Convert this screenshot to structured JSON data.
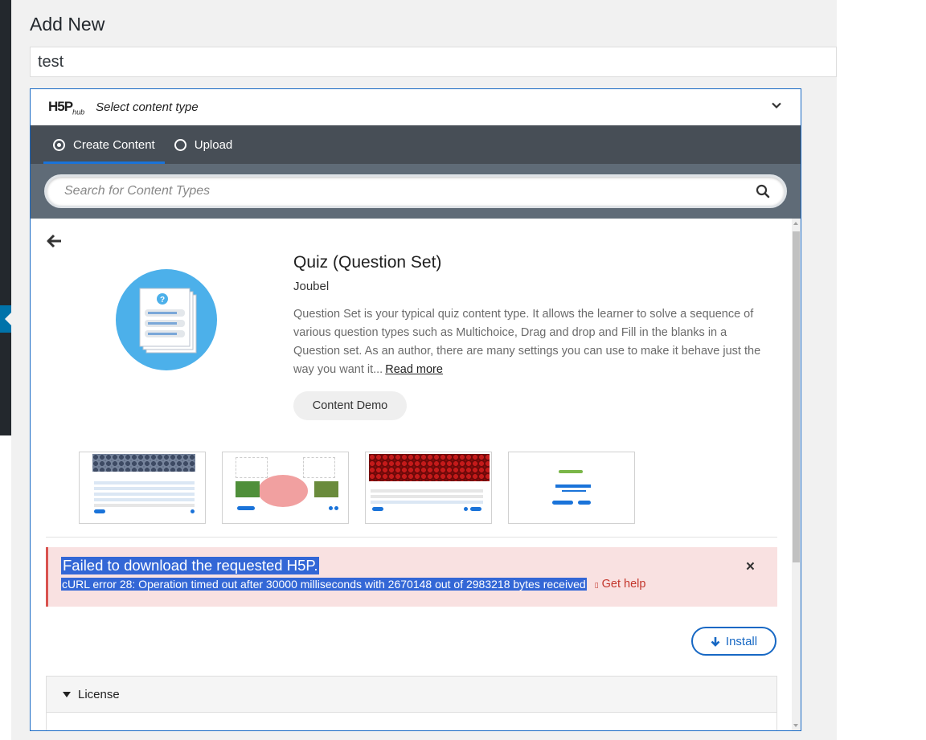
{
  "page": {
    "title": "Add New",
    "title_input_value": "test"
  },
  "hub": {
    "logo_text": "H5P",
    "logo_sub": "hub",
    "select_label": "Select content type",
    "tabs": [
      {
        "label": "Create Content",
        "selected": true
      },
      {
        "label": "Upload",
        "selected": false
      }
    ],
    "search_placeholder": "Search for Content Types"
  },
  "detail": {
    "title": "Quiz (Question Set)",
    "owner": "Joubel",
    "description": "Question Set is your typical quiz content type. It allows the learner to solve a sequence of various question types such as Multichoice, Drag and drop and Fill in the blanks in a Question set. As an author, there are many settings you can use to make it behave just the way you want it...",
    "read_more": "Read more",
    "demo_label": "Content Demo"
  },
  "error": {
    "title": "Failed to download the requested H5P.",
    "message": "cURL error 28: Operation timed out after 30000 milliseconds with 2670148 out of 2983218 bytes received",
    "help_label": "Get help",
    "close_glyph": "×"
  },
  "install_label": "Install",
  "license_label": "License",
  "colors": {
    "hub_border": "#1768c4",
    "tabs_bg": "#474e56",
    "search_bg": "#5f6b77",
    "error_bg": "#f9e1e1",
    "accent": "#1a73d9"
  }
}
